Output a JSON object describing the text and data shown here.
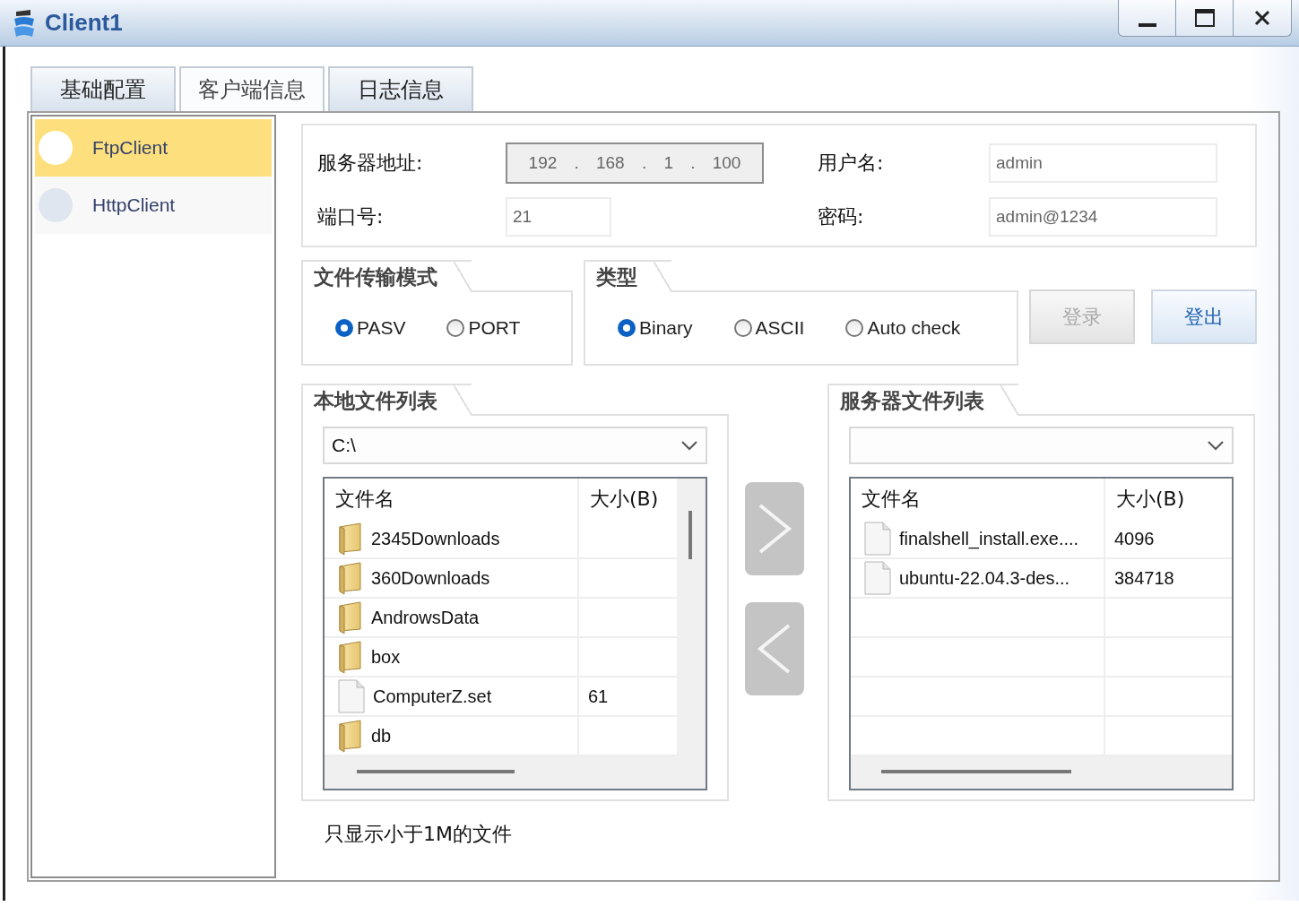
{
  "window": {
    "title": "Client1"
  },
  "tabs": [
    {
      "label": "基础配置",
      "selected": false
    },
    {
      "label": "客户端信息",
      "selected": true
    },
    {
      "label": "日志信息",
      "selected": false
    }
  ],
  "sidebar": {
    "items": [
      {
        "label": "FtpClient",
        "selected": true
      },
      {
        "label": "HttpClient",
        "selected": false
      }
    ]
  },
  "connection": {
    "server_address": {
      "label": "服务器地址:",
      "octets": [
        "192",
        "168",
        "1",
        "100"
      ],
      "separator": ".",
      "disabled": true
    },
    "port": {
      "label": "端口号:",
      "value": "21"
    },
    "username": {
      "label": "用户名:",
      "value": "admin"
    },
    "password": {
      "label": "密码:",
      "value": "admin@1234"
    }
  },
  "transfer_mode": {
    "title": "文件传输模式",
    "options": [
      {
        "label": "PASV",
        "selected": true
      },
      {
        "label": "PORT",
        "selected": false
      }
    ]
  },
  "type": {
    "title": "类型",
    "options": [
      {
        "label": "Binary",
        "selected": true
      },
      {
        "label": "ASCII",
        "selected": false
      },
      {
        "label": "Auto check",
        "selected": false
      }
    ]
  },
  "buttons": [
    {
      "label": "登录",
      "disabled": true
    },
    {
      "label": "登出",
      "disabled": false
    }
  ],
  "local_files": {
    "title": "本地文件列表",
    "path": "C:\\",
    "columns": [
      "文件名",
      "大小(B)"
    ],
    "rows": [
      {
        "kind": "folder",
        "name": "2345Downloads"
      },
      {
        "kind": "folder",
        "name": "360Downloads"
      },
      {
        "kind": "folder",
        "name": "AndrowsData"
      },
      {
        "kind": "folder",
        "name": "box"
      },
      {
        "kind": "file",
        "name": "ComputerZ.set",
        "size": "61"
      },
      {
        "kind": "folder",
        "name": "db"
      }
    ]
  },
  "server_files": {
    "title": "服务器文件列表",
    "columns": [
      "文件名",
      "大小(B)"
    ],
    "rows": [
      {
        "kind": "file",
        "name": "finalshell_install.exe....",
        "size": "4096"
      },
      {
        "kind": "file",
        "name": "ubuntu-22.04.3-des...",
        "size": "384718"
      }
    ]
  },
  "footer_note": "只显示小于1M的文件"
}
